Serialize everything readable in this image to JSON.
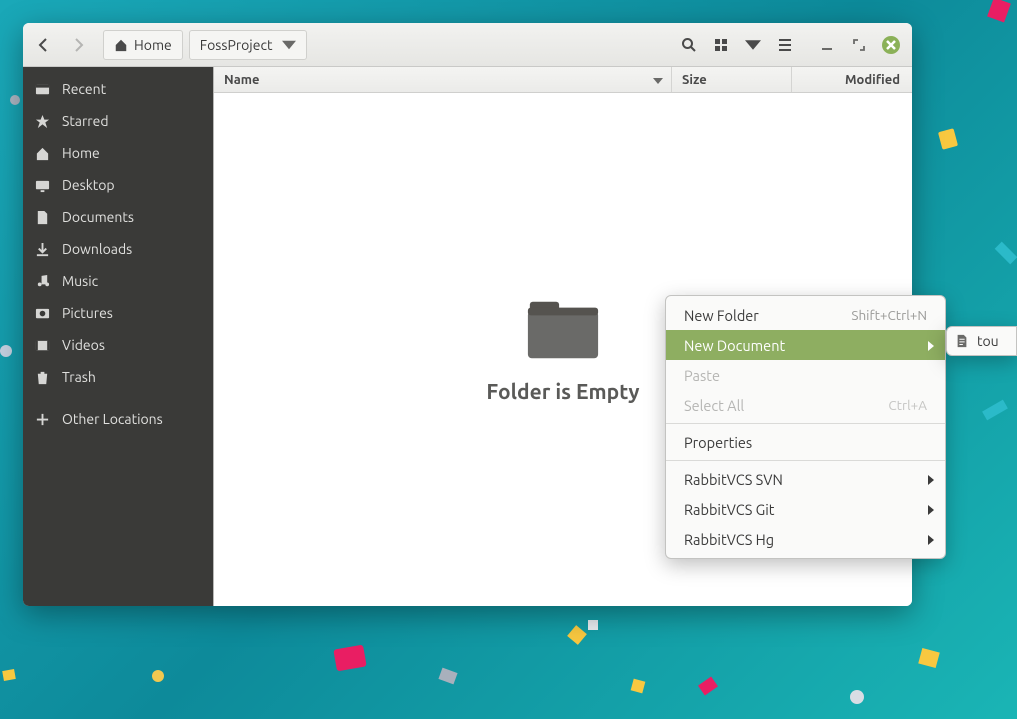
{
  "pathbar": {
    "home_label": "Home",
    "current_label": "FossProject"
  },
  "sidebar": {
    "items": [
      {
        "label": "Recent"
      },
      {
        "label": "Starred"
      },
      {
        "label": "Home"
      },
      {
        "label": "Desktop"
      },
      {
        "label": "Documents"
      },
      {
        "label": "Downloads"
      },
      {
        "label": "Music"
      },
      {
        "label": "Pictures"
      },
      {
        "label": "Videos"
      },
      {
        "label": "Trash"
      }
    ],
    "other_locations": "Other Locations"
  },
  "columns": {
    "name": "Name",
    "size": "Size",
    "modified": "Modified"
  },
  "empty_state": "Folder is Empty",
  "context_menu": {
    "new_folder": {
      "label": "New Folder",
      "shortcut": "Shift+Ctrl+N"
    },
    "new_document": {
      "label": "New Document"
    },
    "paste": {
      "label": "Paste"
    },
    "select_all": {
      "label": "Select All",
      "shortcut": "Ctrl+A"
    },
    "properties": {
      "label": "Properties"
    },
    "rabbit_svn": {
      "label": "RabbitVCS SVN"
    },
    "rabbit_git": {
      "label": "RabbitVCS Git"
    },
    "rabbit_hg": {
      "label": "RabbitVCS Hg"
    }
  },
  "submenu": {
    "item_label": "tou"
  }
}
